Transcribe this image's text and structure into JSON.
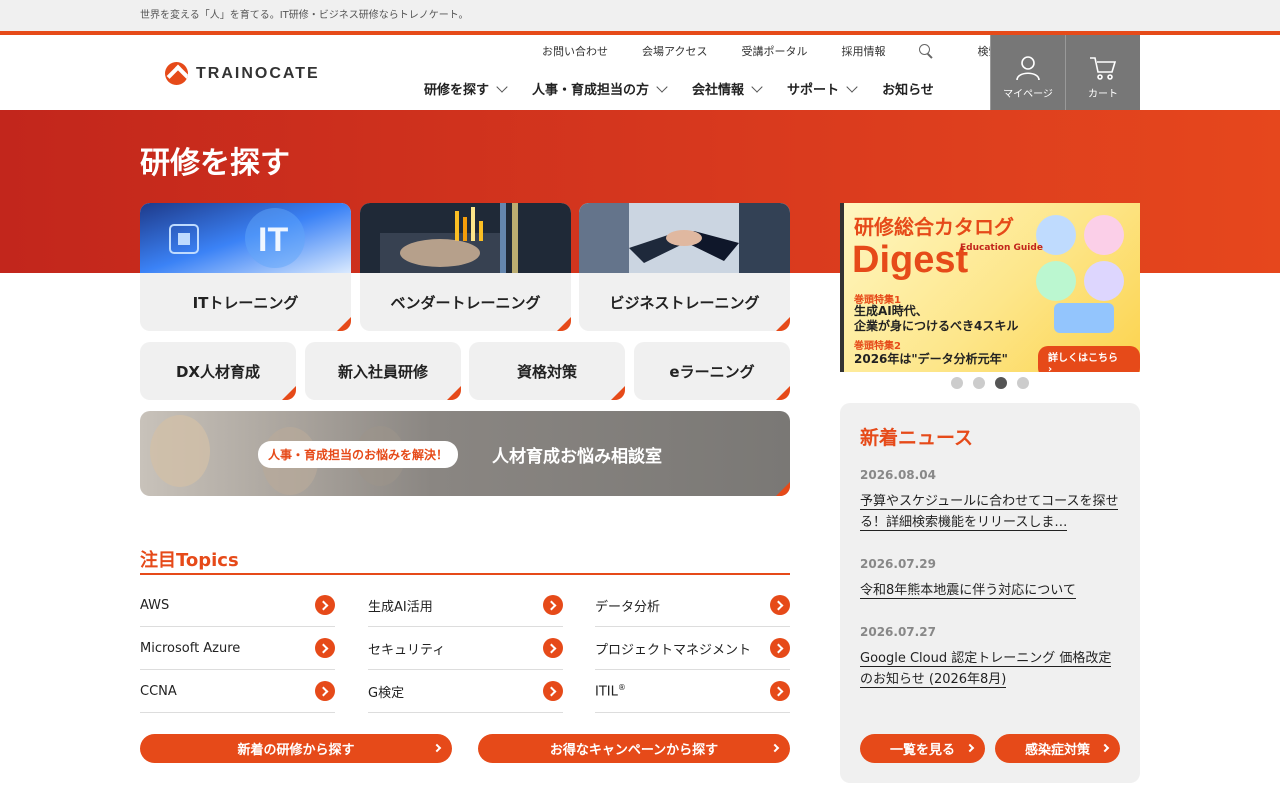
{
  "topbar": {
    "tagline": "世界を変える「人」を育てる。IT研修・ビジネス研修ならトレノケート。"
  },
  "logo": {
    "text": "TRAINOCATE"
  },
  "utility_nav": {
    "contact": "お問い合わせ",
    "access": "会場アクセス",
    "portal": "受講ポータル",
    "careers": "採用情報",
    "search": "検索"
  },
  "main_nav": [
    {
      "label": "研修を探す"
    },
    {
      "label": "人事・育成担当の方"
    },
    {
      "label": "会社情報"
    },
    {
      "label": "サポート"
    },
    {
      "label": "お知らせ"
    }
  ],
  "icon_buttons": {
    "mypage": "マイページ",
    "cart": "カート"
  },
  "hero": {
    "title": "研修を探す"
  },
  "categories_big": [
    {
      "label": "ITトレーニング"
    },
    {
      "label": "ベンダートレーニング"
    },
    {
      "label": "ビジネストレーニング"
    }
  ],
  "categories_small": [
    {
      "label": "DX人材育成"
    },
    {
      "label": "新入社員研修"
    },
    {
      "label": "資格対策"
    },
    {
      "label": "eラーニング"
    }
  ],
  "consult": {
    "pill": "人事・育成担当のお悩みを解決！",
    "title": "人材育成お悩み相談室"
  },
  "topics": {
    "title": "注目Topics",
    "items": [
      {
        "label": "AWS"
      },
      {
        "label": "生成AI活用"
      },
      {
        "label": "データ分析"
      },
      {
        "label": "Microsoft Azure"
      },
      {
        "label": "セキュリティ"
      },
      {
        "label": "プロジェクトマネジメント"
      },
      {
        "label": "CCNA"
      },
      {
        "label": "G検定"
      },
      {
        "label": "ITIL"
      }
    ],
    "itil_sup": "®"
  },
  "bottom_buttons": {
    "new_courses": "新着の研修から探す",
    "campaign": "お得なキャンペーンから探す"
  },
  "banner": {
    "title": "研修総合カタログ",
    "digest": "Digest",
    "edu": "Education Guide",
    "feature1_label": "巻頭特集1",
    "feature1_line1": "生成AI時代、",
    "feature1_line2": "企業が身につけるべき4スキル",
    "feature2_label": "巻頭特集2",
    "feature2_text": "2026年は\"データ分析元年\"",
    "button": "詳しくはこちら"
  },
  "carousel": {
    "count": 4,
    "active": 3
  },
  "news": {
    "title": "新着ニュース",
    "items": [
      {
        "date": "2026.08.04",
        "text": "予算やスケジュールに合わせてコースを探せる！詳細検索機能をリリースしま…"
      },
      {
        "date": "2026.07.29",
        "text": "令和8年熊本地震に伴う対応について"
      },
      {
        "date": "2026.07.27",
        "text": "Google Cloud 認定トレーニング 価格改定のお知らせ (2026年8月)"
      }
    ],
    "list_button": "一覧を見る",
    "covid_button": "感染症対策"
  },
  "colors": {
    "accent": "#e64a19",
    "hero_red": "#c2261c",
    "panel_gray": "#f0f0f0",
    "icon_btn_gray": "#777777"
  }
}
